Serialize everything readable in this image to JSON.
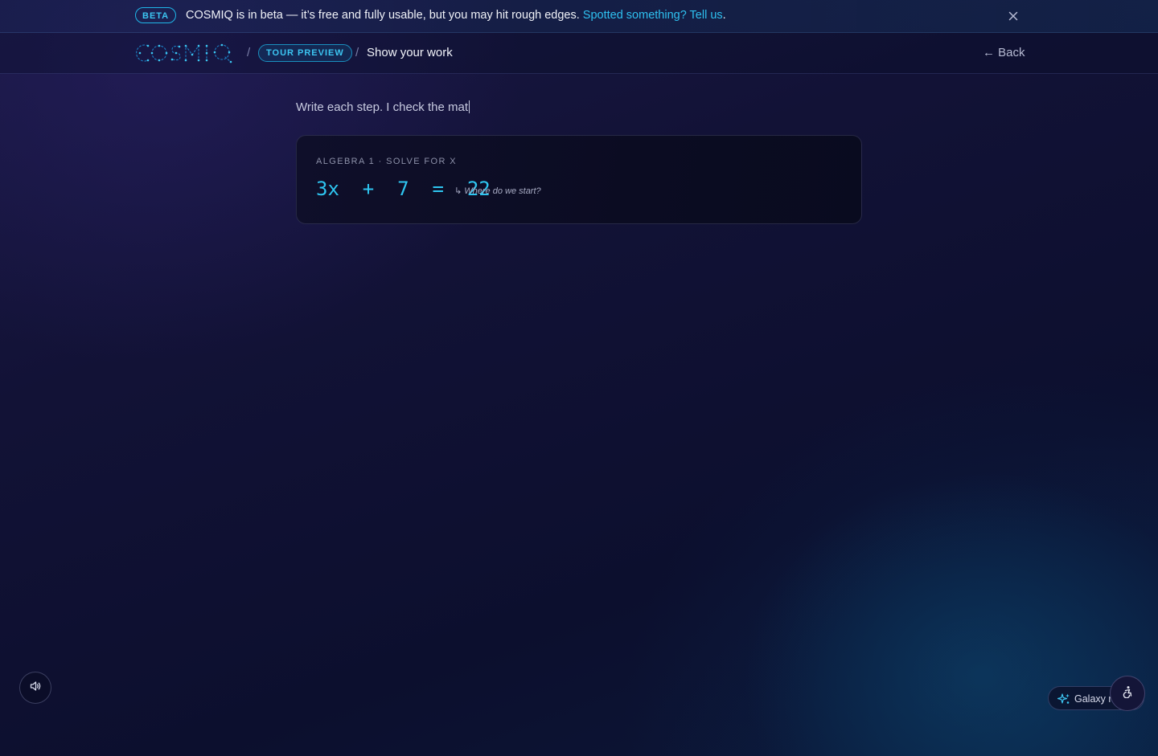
{
  "beta_banner": {
    "badge": "BETA",
    "message": "COSMIQ is in beta — it’s free and fully usable, but you may hit rough edges. ",
    "link_text": "Spotted something? Tell us",
    "trailing": ".",
    "close_icon": "close-icon"
  },
  "nav": {
    "logo_text": "COSMIQ",
    "separator": "/",
    "tour_badge": "TOUR PREVIEW",
    "current_page": "Show your work",
    "back_label": "← Back"
  },
  "main": {
    "intro_text": "Write each step. I check the mat",
    "card": {
      "label": "ALGEBRA 1 · SOLVE FOR X",
      "equation": "3x + 7 = 22",
      "hint": "↳ Where do we start?"
    }
  },
  "controls": {
    "sound_icon": "speaker-icon",
    "galaxy_label": "Galaxy m",
    "galaxy_icon": "sparkle-icon",
    "accessibility_icon": "accessibility-icon"
  },
  "colors": {
    "accent": "#2ec5f0",
    "background": "#121236"
  }
}
